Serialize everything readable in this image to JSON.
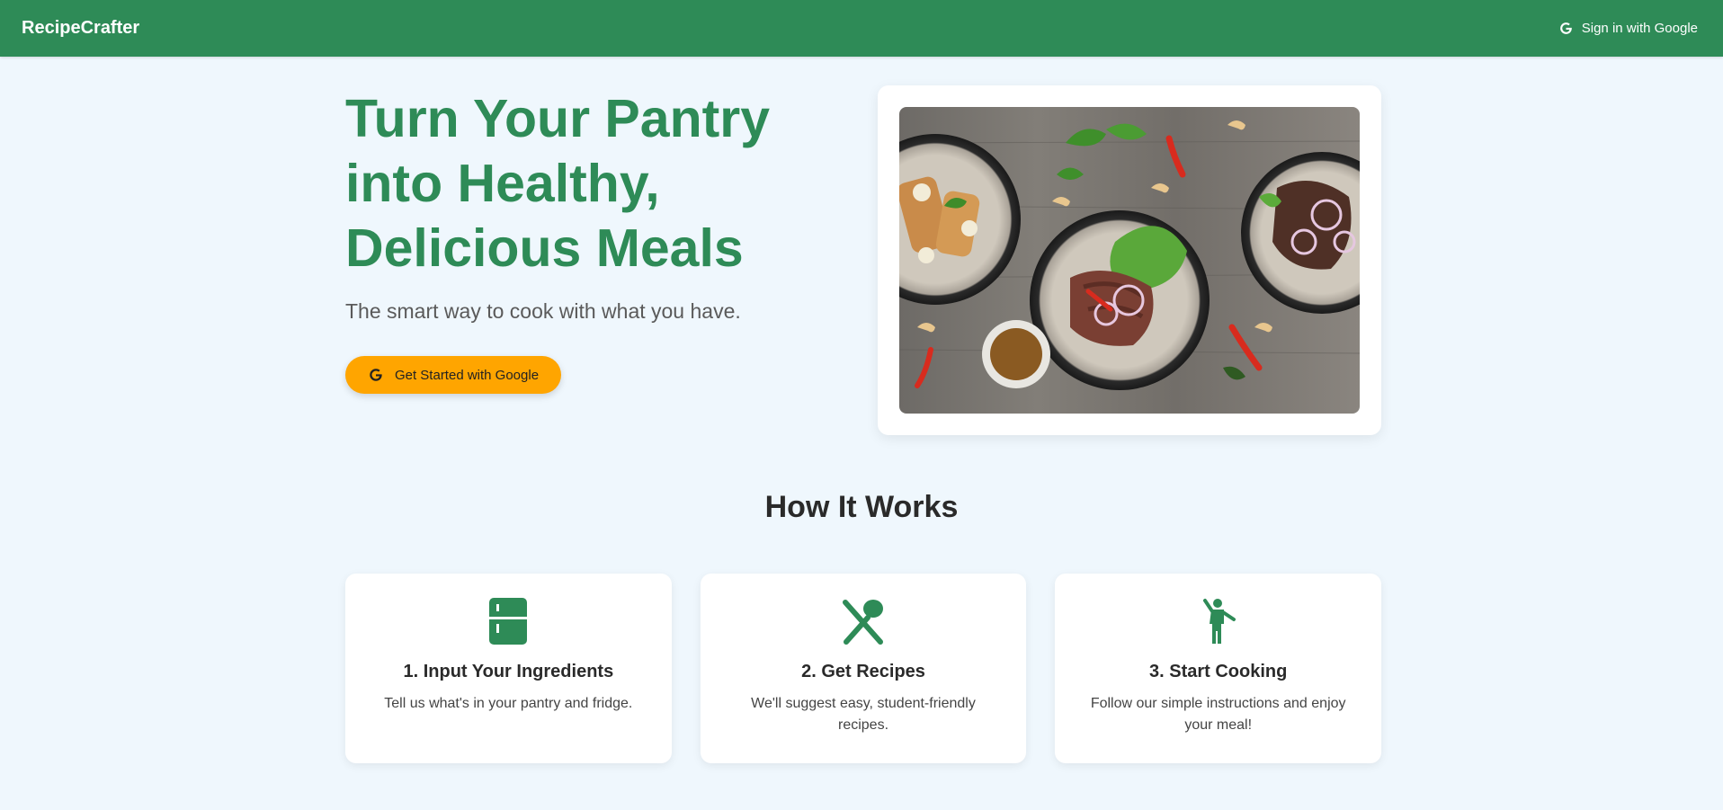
{
  "header": {
    "brand": "RecipeCrafter",
    "signin_label": "Sign in with Google",
    "signin_icon": "google-g-icon",
    "background": "#2e8b57"
  },
  "hero": {
    "title_lines": [
      "Turn Your Pantry",
      "into Healthy,",
      "Delicious Meals"
    ],
    "subtitle": "The smart way to cook with what you have.",
    "cta_label": "Get Started with Google",
    "cta_icon": "google-g-icon",
    "cta_color": "#ffa500",
    "title_color": "#2e8b57",
    "image_alt": "food-bowls-photo"
  },
  "how_it_works": {
    "title": "How It Works",
    "steps": [
      {
        "icon": "fridge-icon",
        "title": "1. Input Your Ingredients",
        "text": "Tell us what's in your pantry and fridge."
      },
      {
        "icon": "utensils-icon",
        "title": "2. Get Recipes",
        "text": "We'll suggest easy, student-friendly recipes."
      },
      {
        "icon": "person-cooking-icon",
        "title": "3. Start Cooking",
        "text": "Follow our simple instructions and enjoy your meal!"
      }
    ]
  },
  "colors": {
    "accent": "#2e8b57",
    "cta": "#ffa500",
    "page_bg": "#eff7fd"
  }
}
